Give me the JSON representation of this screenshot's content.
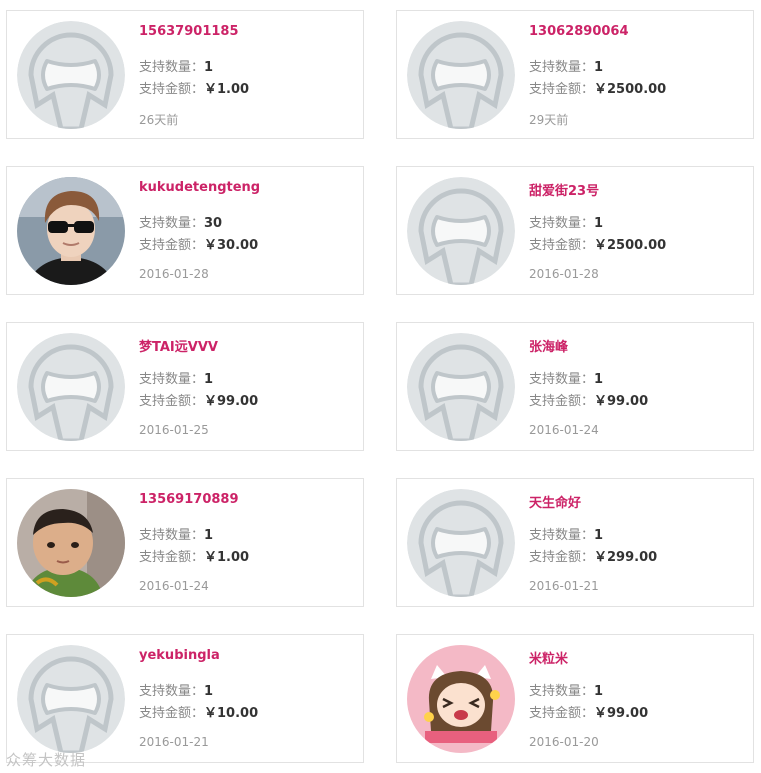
{
  "qty_label": "支持数量：",
  "amount_label": "支持金额：",
  "watermark": "众筹大数据",
  "backers": [
    {
      "name": "15637901185",
      "quantity": "1",
      "amount": "￥1.00",
      "time": "26天前",
      "avatar": "default-avatar-icon"
    },
    {
      "name": "13062890064",
      "quantity": "1",
      "amount": "￥2500.00",
      "time": "29天前",
      "avatar": "default-avatar-icon"
    },
    {
      "name": "kukudetengteng",
      "quantity": "30",
      "amount": "￥30.00",
      "time": "2016-01-28",
      "avatar": "user-photo-sunglasses"
    },
    {
      "name": "甜爱街23号",
      "quantity": "1",
      "amount": "￥2500.00",
      "time": "2016-01-28",
      "avatar": "default-avatar-icon"
    },
    {
      "name": "梦TAI远VVV",
      "quantity": "1",
      "amount": "￥99.00",
      "time": "2016-01-25",
      "avatar": "default-avatar-icon"
    },
    {
      "name": "张海峰",
      "quantity": "1",
      "amount": "￥99.00",
      "time": "2016-01-24",
      "avatar": "default-avatar-icon"
    },
    {
      "name": "13569170889",
      "quantity": "1",
      "amount": "￥1.00",
      "time": "2016-01-24",
      "avatar": "user-photo-child"
    },
    {
      "name": "天生命好",
      "quantity": "1",
      "amount": "￥299.00",
      "time": "2016-01-21",
      "avatar": "default-avatar-icon"
    },
    {
      "name": "yekubingla",
      "quantity": "1",
      "amount": "￥10.00",
      "time": "2016-01-21",
      "avatar": "default-avatar-icon"
    },
    {
      "name": "米粒米",
      "quantity": "1",
      "amount": "￥99.00",
      "time": "2016-01-20",
      "avatar": "cartoon-girl-avatar"
    }
  ]
}
